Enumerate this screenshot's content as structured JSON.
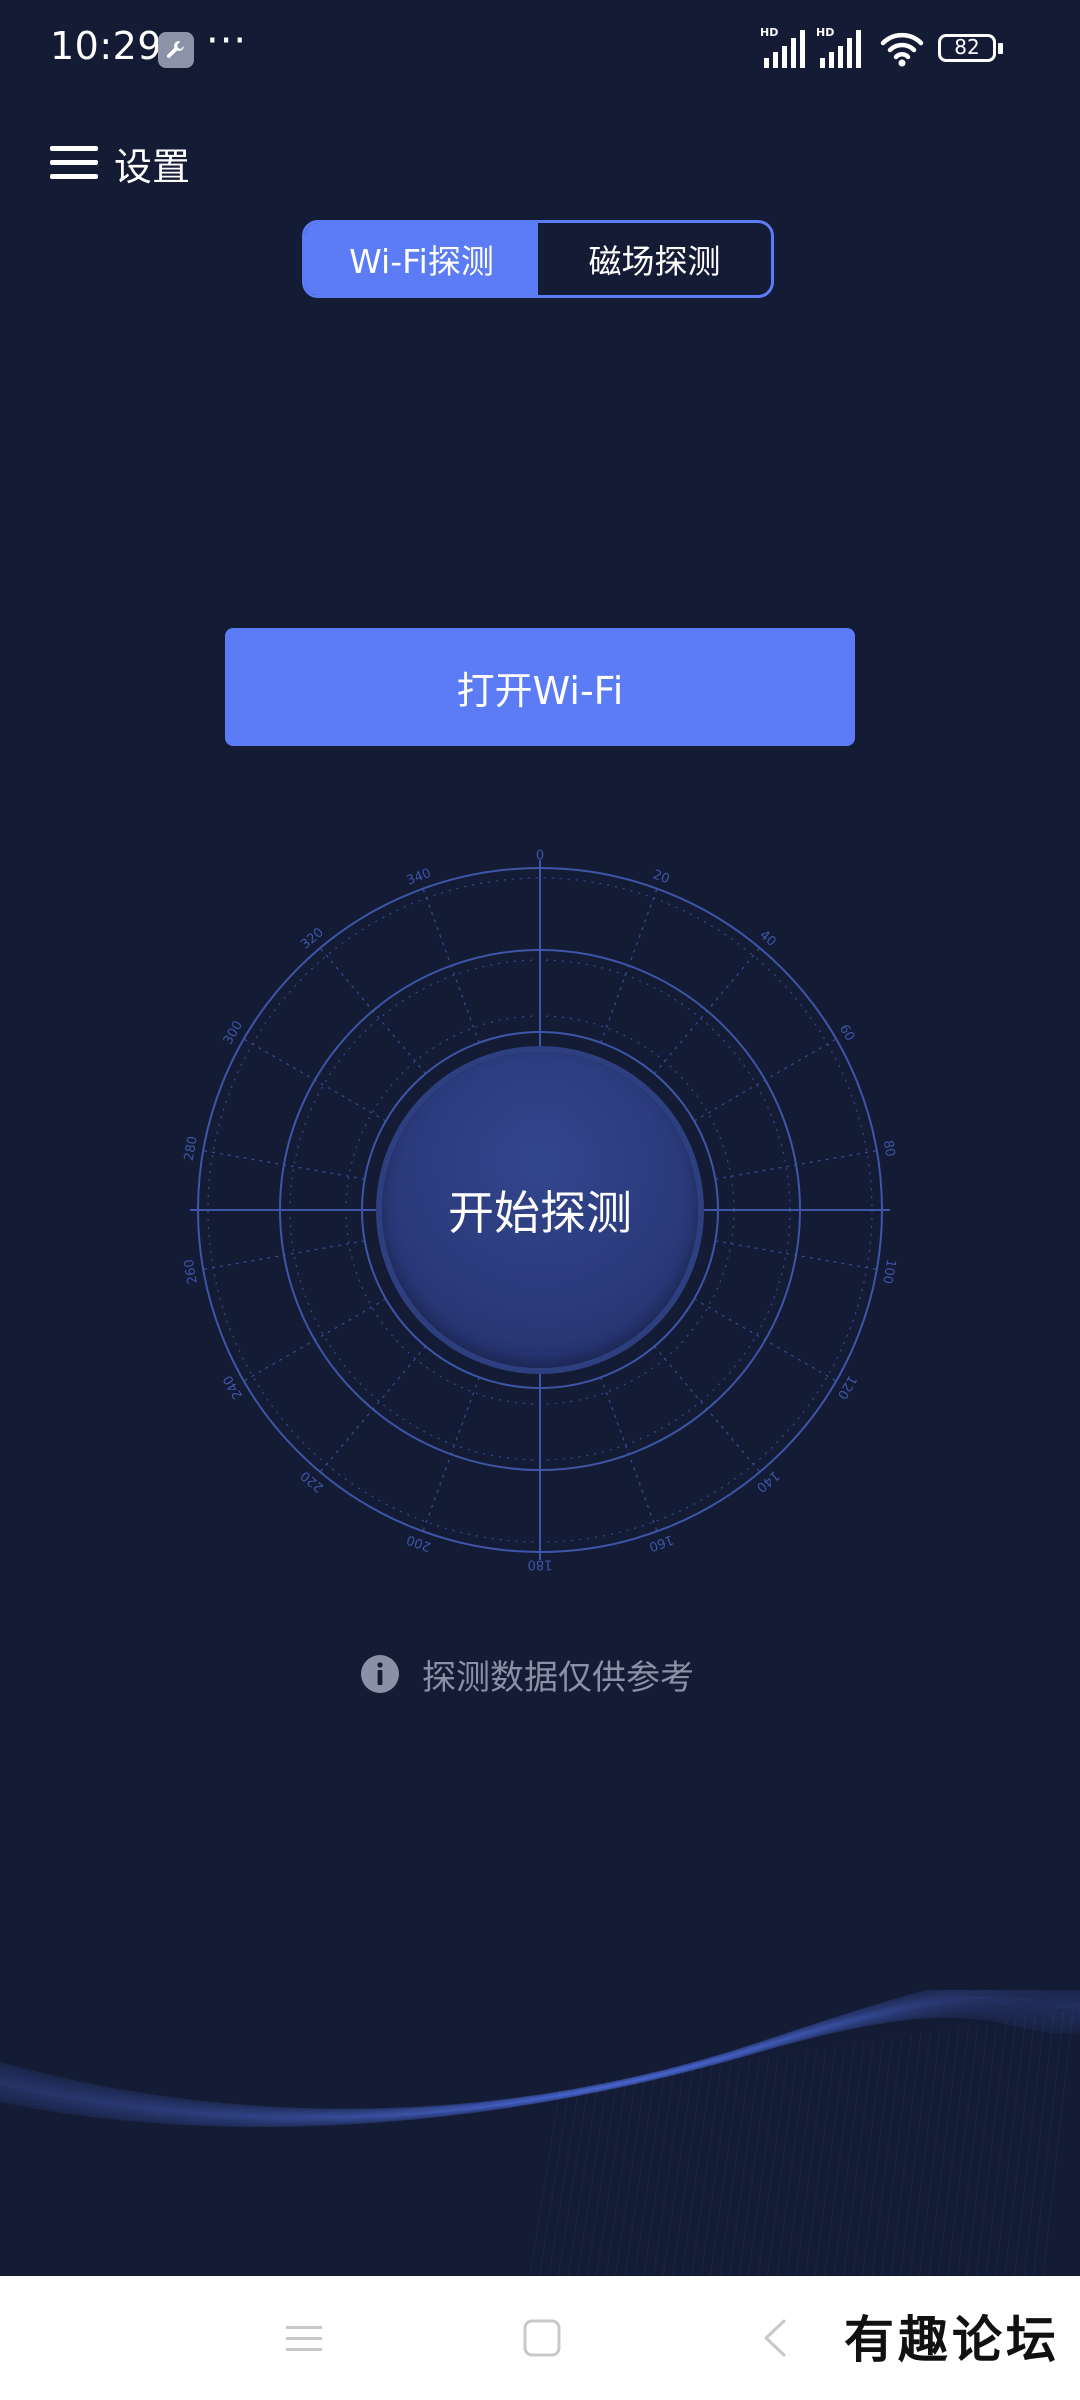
{
  "status_bar": {
    "time": "10:29",
    "more": "···",
    "network_1": "HD",
    "network_2": "HD",
    "battery": "82"
  },
  "header": {
    "settings_label": "设置"
  },
  "tabs": [
    {
      "label": "Wi-Fi探测",
      "active": true
    },
    {
      "label": "磁场探测",
      "active": false
    }
  ],
  "open_wifi_button": "打开Wi-Fi",
  "compass": {
    "degree_labels": [
      "0",
      "20",
      "40",
      "60",
      "80",
      "100",
      "120",
      "140",
      "160",
      "180",
      "200",
      "220",
      "240",
      "260",
      "280",
      "300",
      "320",
      "340"
    ],
    "start_button": "开始探测"
  },
  "note": {
    "text": "探测数据仅供参考"
  },
  "watermark": "有趣论坛",
  "colors": {
    "background": "#141b34",
    "accent": "#5b7cf5",
    "compass_line": "#3f55a8",
    "note_text": "#8a90a6"
  }
}
